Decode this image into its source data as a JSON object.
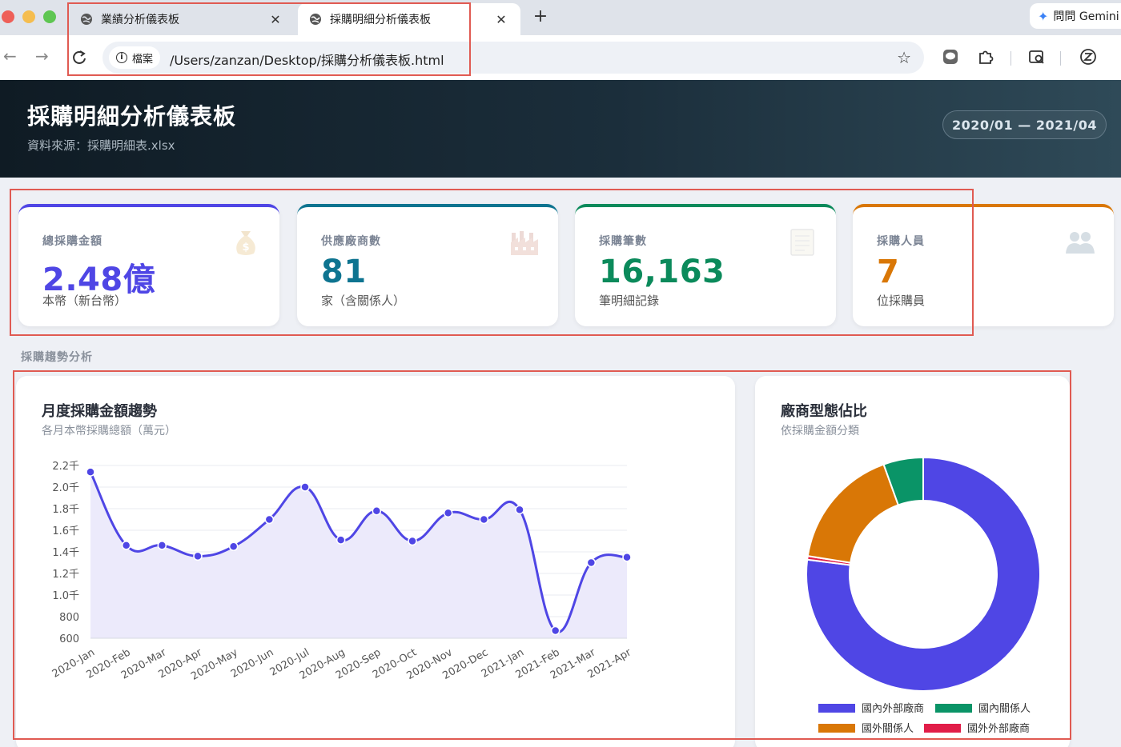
{
  "browser": {
    "tabs": [
      {
        "title": "業績分析儀表板",
        "active": false
      },
      {
        "title": "採購明細分析儀表板",
        "active": true
      }
    ],
    "new_tab_label": "+",
    "gemini_label": "問問 Gemini",
    "security_chip": "檔案",
    "url": "/Users/zanzan/Desktop/採購分析儀表板.html"
  },
  "header": {
    "title": "採購明細分析儀表板",
    "source": "資料來源：採購明細表.xlsx",
    "date_range": "2020/01 — 2021/04"
  },
  "kpis": [
    {
      "label": "總採購金額",
      "value": "2.48億",
      "sub": "本幣（新台幣）",
      "color": "#4f46e5",
      "icon": "money-bag-icon"
    },
    {
      "label": "供應廠商數",
      "value": "81",
      "sub": "家（含關係人）",
      "color": "#0e7490",
      "icon": "factory-icon"
    },
    {
      "label": "採購筆數",
      "value": "16,163",
      "sub": "筆明細記錄",
      "color": "#0b8a5b",
      "icon": "document-icon"
    },
    {
      "label": "採購人員",
      "value": "7",
      "sub": "位採購員",
      "color": "#d97706",
      "icon": "people-icon"
    }
  ],
  "section_title": "採購趨勢分析",
  "line_card": {
    "title": "月度採購金額趨勢",
    "subtitle": "各月本幣採購總額（萬元）"
  },
  "pie_card": {
    "title": "廠商型態佔比",
    "subtitle": "依採購金額分類"
  },
  "chart_data": [
    {
      "type": "line",
      "title": "月度採購金額趨勢",
      "subtitle": "各月本幣採購總額（萬元）",
      "x": [
        "2020-Jan",
        "2020-Feb",
        "2020-Mar",
        "2020-Apr",
        "2020-May",
        "2020-Jun",
        "2020-Jul",
        "2020-Aug",
        "2020-Sep",
        "2020-Oct",
        "2020-Nov",
        "2020-Dec",
        "2021-Jan",
        "2021-Feb",
        "2021-Mar",
        "2021-Apr"
      ],
      "values": [
        2140,
        1460,
        1460,
        1360,
        1450,
        1700,
        2000,
        1510,
        1780,
        1500,
        1760,
        1700,
        1790,
        670,
        1300,
        1350
      ],
      "yticks": [
        600,
        800,
        1000,
        1200,
        1400,
        1600,
        1800,
        2000,
        2200
      ],
      "ytick_labels": [
        "600",
        "800",
        "1.0千",
        "1.2千",
        "1.4千",
        "1.6千",
        "1.8千",
        "2.0千",
        "2.2千"
      ],
      "ylim": [
        600,
        2200
      ],
      "color": "#4f46e5",
      "fill": "#eceafb",
      "grid": true
    },
    {
      "type": "pie",
      "title": "廠商型態佔比",
      "subtitle": "依採購金額分類",
      "categories": [
        "國內外部廠商",
        "國內關係人",
        "國外關係人",
        "國外外部廠商"
      ],
      "values": [
        77.0,
        5.5,
        17.0,
        0.5
      ],
      "colors": [
        "#4f46e5",
        "#0a9467",
        "#d97706",
        "#e11d48"
      ],
      "draw_order": [
        0,
        3,
        2,
        1
      ],
      "legend_position": "bottom"
    }
  ]
}
